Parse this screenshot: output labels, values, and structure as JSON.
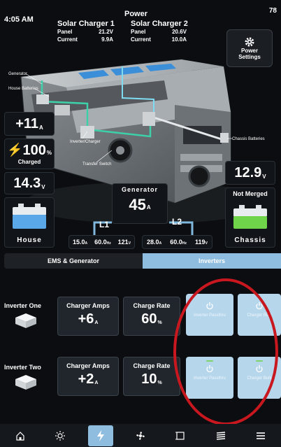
{
  "status_bar": {
    "time": "4:05 AM",
    "battery": "78"
  },
  "power": {
    "title": "Power",
    "solar_charger_1": {
      "title": "Solar Charger 1",
      "panel_label": "Panel",
      "panel_value": "21.2V",
      "current_label": "Current",
      "current_value": "9.9A"
    },
    "solar_charger_2": {
      "title": "Solar Charger 2",
      "panel_label": "Panel",
      "panel_value": "20.6V",
      "current_label": "Current",
      "current_value": "10.0A"
    },
    "settings_button": {
      "label_line1": "Power",
      "label_line2": "Settings",
      "icon": "gear-icon"
    }
  },
  "diagram_labels": {
    "generator": "Generator",
    "house_batteries": "House Batteries",
    "inverter_charger": "Inverter/Charger",
    "transfer_switch": "Transfer Switch",
    "chassis_batteries": "Chassis Batteries"
  },
  "house": {
    "current_value": "+11",
    "current_unit": "A",
    "charge_value": "100",
    "charge_unit": "%",
    "charge_label": "Charged",
    "voltage_value": "14.3",
    "voltage_unit": "V",
    "label": "House"
  },
  "chassis": {
    "voltage_value": "12.9",
    "voltage_unit": "V",
    "status": "Not Merged",
    "label": "Chassis"
  },
  "generator": {
    "label": "Generator",
    "value": "45",
    "unit": "A"
  },
  "circuits": {
    "l1": {
      "label": "L1",
      "amps": "15.0",
      "amps_unit": "A",
      "hz": "60.0",
      "hz_unit": "Hz",
      "volts": "121",
      "volts_unit": "V"
    },
    "l2": {
      "label": "L2",
      "amps": "28.0",
      "amps_unit": "A",
      "hz": "60.0",
      "hz_unit": "Hz",
      "volts": "119",
      "volts_unit": "V"
    }
  },
  "tabs": [
    {
      "label": "EMS & Generator",
      "active": false
    },
    {
      "label": "Inverters",
      "active": true
    }
  ],
  "inverters": [
    {
      "name": "Inverter One",
      "charger_amps_label": "Charger Amps",
      "charger_amps_value": "+6",
      "charger_amps_unit": "A",
      "charge_rate_label": "Charge Rate",
      "charge_rate_value": "60",
      "charge_rate_unit": "%",
      "toggle1_label": "Inverter Passthru",
      "toggle2_label": "Charger Bulk"
    },
    {
      "name": "Inverter Two",
      "charger_amps_label": "Charger Amps",
      "charger_amps_value": "+2",
      "charger_amps_unit": "A",
      "charge_rate_label": "Charge Rate",
      "charge_rate_value": "10",
      "charge_rate_unit": "%",
      "toggle1_label": "Inverter Passthru",
      "toggle2_label": "Charger Bulk"
    }
  ],
  "nav": [
    {
      "icon": "home-icon"
    },
    {
      "icon": "light-icon"
    },
    {
      "icon": "power-icon",
      "active": true
    },
    {
      "icon": "fan-icon"
    },
    {
      "icon": "slide-icon"
    },
    {
      "icon": "awning-icon"
    },
    {
      "icon": "menu-icon"
    }
  ],
  "colors": {
    "accent": "#8fbde0",
    "toggle": "#b6d6ec",
    "panel_blue": "#3b8fd9",
    "wire_green": "#3ed0a8",
    "annotation": "#c8171e"
  }
}
